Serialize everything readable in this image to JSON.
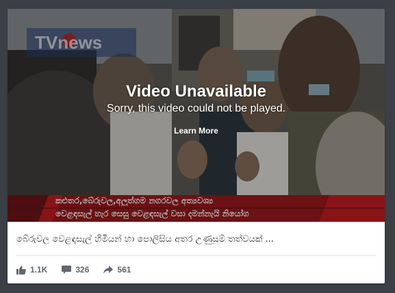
{
  "video": {
    "title": "Video Unavailable",
    "subtitle": "Sorry, this video could not be played.",
    "learn_more": "Learn More",
    "watermark": "TVnews",
    "ticker_line1": "කළුතර,බේරුවල,අලුත්ගම නගරවල අත්‍යවශ්‍ය",
    "ticker_line2": "වෙළඳසැල් හැර සෙසු වෙළඳසැල් වසා දමන්නැයි නියෝග"
  },
  "post": {
    "caption": "බේරුවල වෙළඳසැල් හිමියන් හා පොලිසිය අතර උණුසුම් තත්වයක් ..."
  },
  "stats": {
    "likes": "1.1K",
    "comments": "326",
    "shares": "561"
  },
  "icons": {
    "likes": "thumbs-up-icon",
    "comments": "comment-icon",
    "shares": "share-icon"
  },
  "colors": {
    "background": "#3b3f46",
    "ticker_red": "#c8141a",
    "stat_text": "#606770"
  }
}
